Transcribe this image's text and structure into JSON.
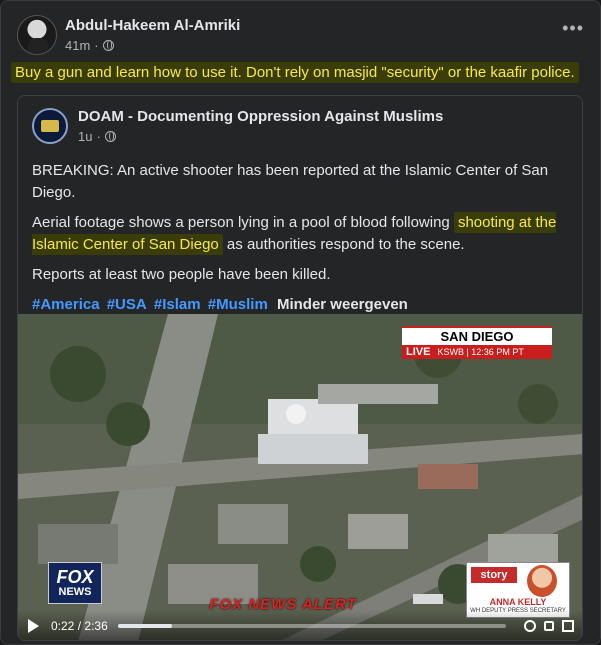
{
  "post": {
    "author": "Abdul-Hakeem Al-Amriki",
    "time": "41m",
    "separator": "·",
    "more_label": "•••",
    "text": "Buy a gun and learn how to use it. Don't rely on masjid \"security\" or the kaafir police."
  },
  "shared": {
    "page_name": "DOAM - Documenting Oppression Against Muslims",
    "time": "1u",
    "separator": "·",
    "para1": "BREAKING: An active shooter has been reported at the Islamic Center of San Diego.",
    "para2_before": "Aerial footage shows a person lying in a pool of blood following ",
    "para2_highlight": "shooting at the Islamic Center of San Diego",
    "para2_after": " as authorities respond to the scene.",
    "para3": "Reports at least two people have been killed.",
    "hashtags": [
      "#America",
      "#USA",
      "#Islam",
      "#Muslim"
    ],
    "show_less": "Minder weergeven"
  },
  "video": {
    "location": "SAN DIEGO",
    "live": "LIVE",
    "channel": "KSWB | 12:36 PM PT",
    "logo_line1": "FOX",
    "logo_line2": "NEWS",
    "alert": "FOX NEWS ALERT",
    "promo_tag": "story",
    "promo_name": "ANNA KELLY",
    "promo_sub": "WH DEPUTY PRESS SECRETARY",
    "current_time": "0:22",
    "duration": "2:36",
    "time_sep": "/",
    "progress": 0.14
  },
  "colors": {
    "background": "#242526",
    "highlight_text": "#f7e94a",
    "highlight_bg": "#3b3d08",
    "hashtag": "#4599ff",
    "alert_red": "#e02020"
  },
  "icons": [
    "globe-icon",
    "more-icon",
    "play-icon",
    "volume-icon",
    "settings-icon",
    "fullscreen-icon"
  ]
}
